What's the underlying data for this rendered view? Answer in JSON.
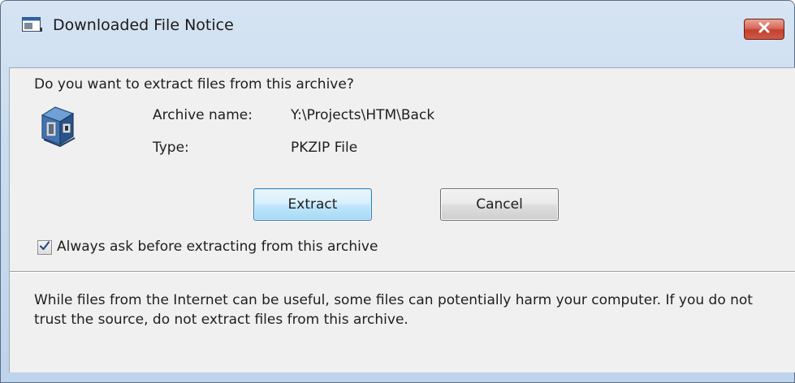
{
  "window": {
    "title": "Downloaded File Notice",
    "close_symbol": "✕",
    "app_icon": "archive-window-icon",
    "close_icon": "close-icon"
  },
  "dialog": {
    "question": "Do you want to extract files from this archive?",
    "archive_icon": "zip-archive-icon",
    "fields": {
      "archive_name_label": "Archive name:",
      "archive_name_value": "Y:\\Projects\\HTM\\Back",
      "type_label": "Type:",
      "type_value": "PKZIP File"
    },
    "buttons": {
      "extract": "Extract",
      "cancel": "Cancel"
    },
    "checkbox": {
      "label": "Always ask before extracting from this archive",
      "checked": true,
      "check_symbol": "✓"
    },
    "notice": "While files from the Internet can be useful, some files can potentially harm your computer. If you do not trust the source, do not extract files from this archive."
  },
  "colors": {
    "titlebar": "#c9dcf0",
    "close_button": "#c2412f",
    "client_bg": "#f0f0f0",
    "default_button_border": "#3c7fb1"
  }
}
